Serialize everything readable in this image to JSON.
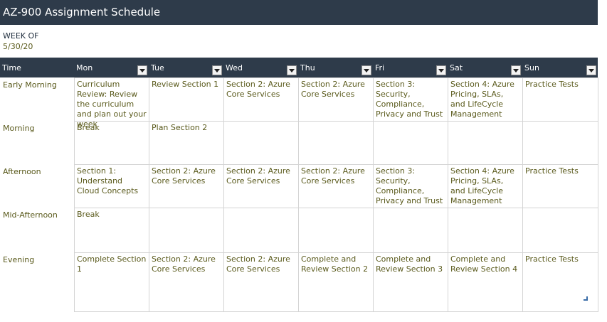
{
  "title": "AZ-900 Assignment Schedule",
  "week_of_label": "WEEK OF",
  "week_of_date": "5/30/20",
  "columns": [
    "Time",
    "Mon",
    "Tue",
    "Wed",
    "Thu",
    "Fri",
    "Sat",
    "Sun"
  ],
  "rows": [
    {
      "time": "Early Morning",
      "cells": [
        "Curriculum Review: Review the curriculum and plan out your week",
        "Review Section 1",
        "Section 2: Azure Core Services",
        "Section 2: Azure Core Services",
        "Section 3: Security, Compliance, Privacy and Trust",
        "Section 4: Azure Pricing, SLAs, and LifeCycle Management",
        "Practice Tests"
      ]
    },
    {
      "time": "Morning",
      "cells": [
        "Break",
        "Plan Section 2",
        "",
        "",
        "",
        "",
        ""
      ]
    },
    {
      "time": "Afternoon",
      "cells": [
        "Section 1: Understand Cloud Concepts",
        "Section 2: Azure Core Services",
        "Section 2: Azure Core Services",
        "Section 2: Azure Core Services",
        "Section 3: Security, Compliance, Privacy and Trust",
        "Section 4: Azure Pricing, SLAs, and LifeCycle Management",
        "Practice Tests"
      ]
    },
    {
      "time": "Mid-Afternoon",
      "cells": [
        "Break",
        "",
        "",
        "",
        "",
        "",
        ""
      ]
    },
    {
      "time": "Evening",
      "cells": [
        "Complete Section 1",
        "Section 2: Azure Core Services",
        "Section 2: Azure Core Services",
        "Complete and Review Section 2",
        "Complete and Review Section 3",
        "Complete and Review Section 4",
        "Practice Tests"
      ]
    }
  ],
  "colors": {
    "header_bg": "#2e3b4a",
    "cell_text": "#5a5a1c",
    "border": "#d4d4d4"
  }
}
